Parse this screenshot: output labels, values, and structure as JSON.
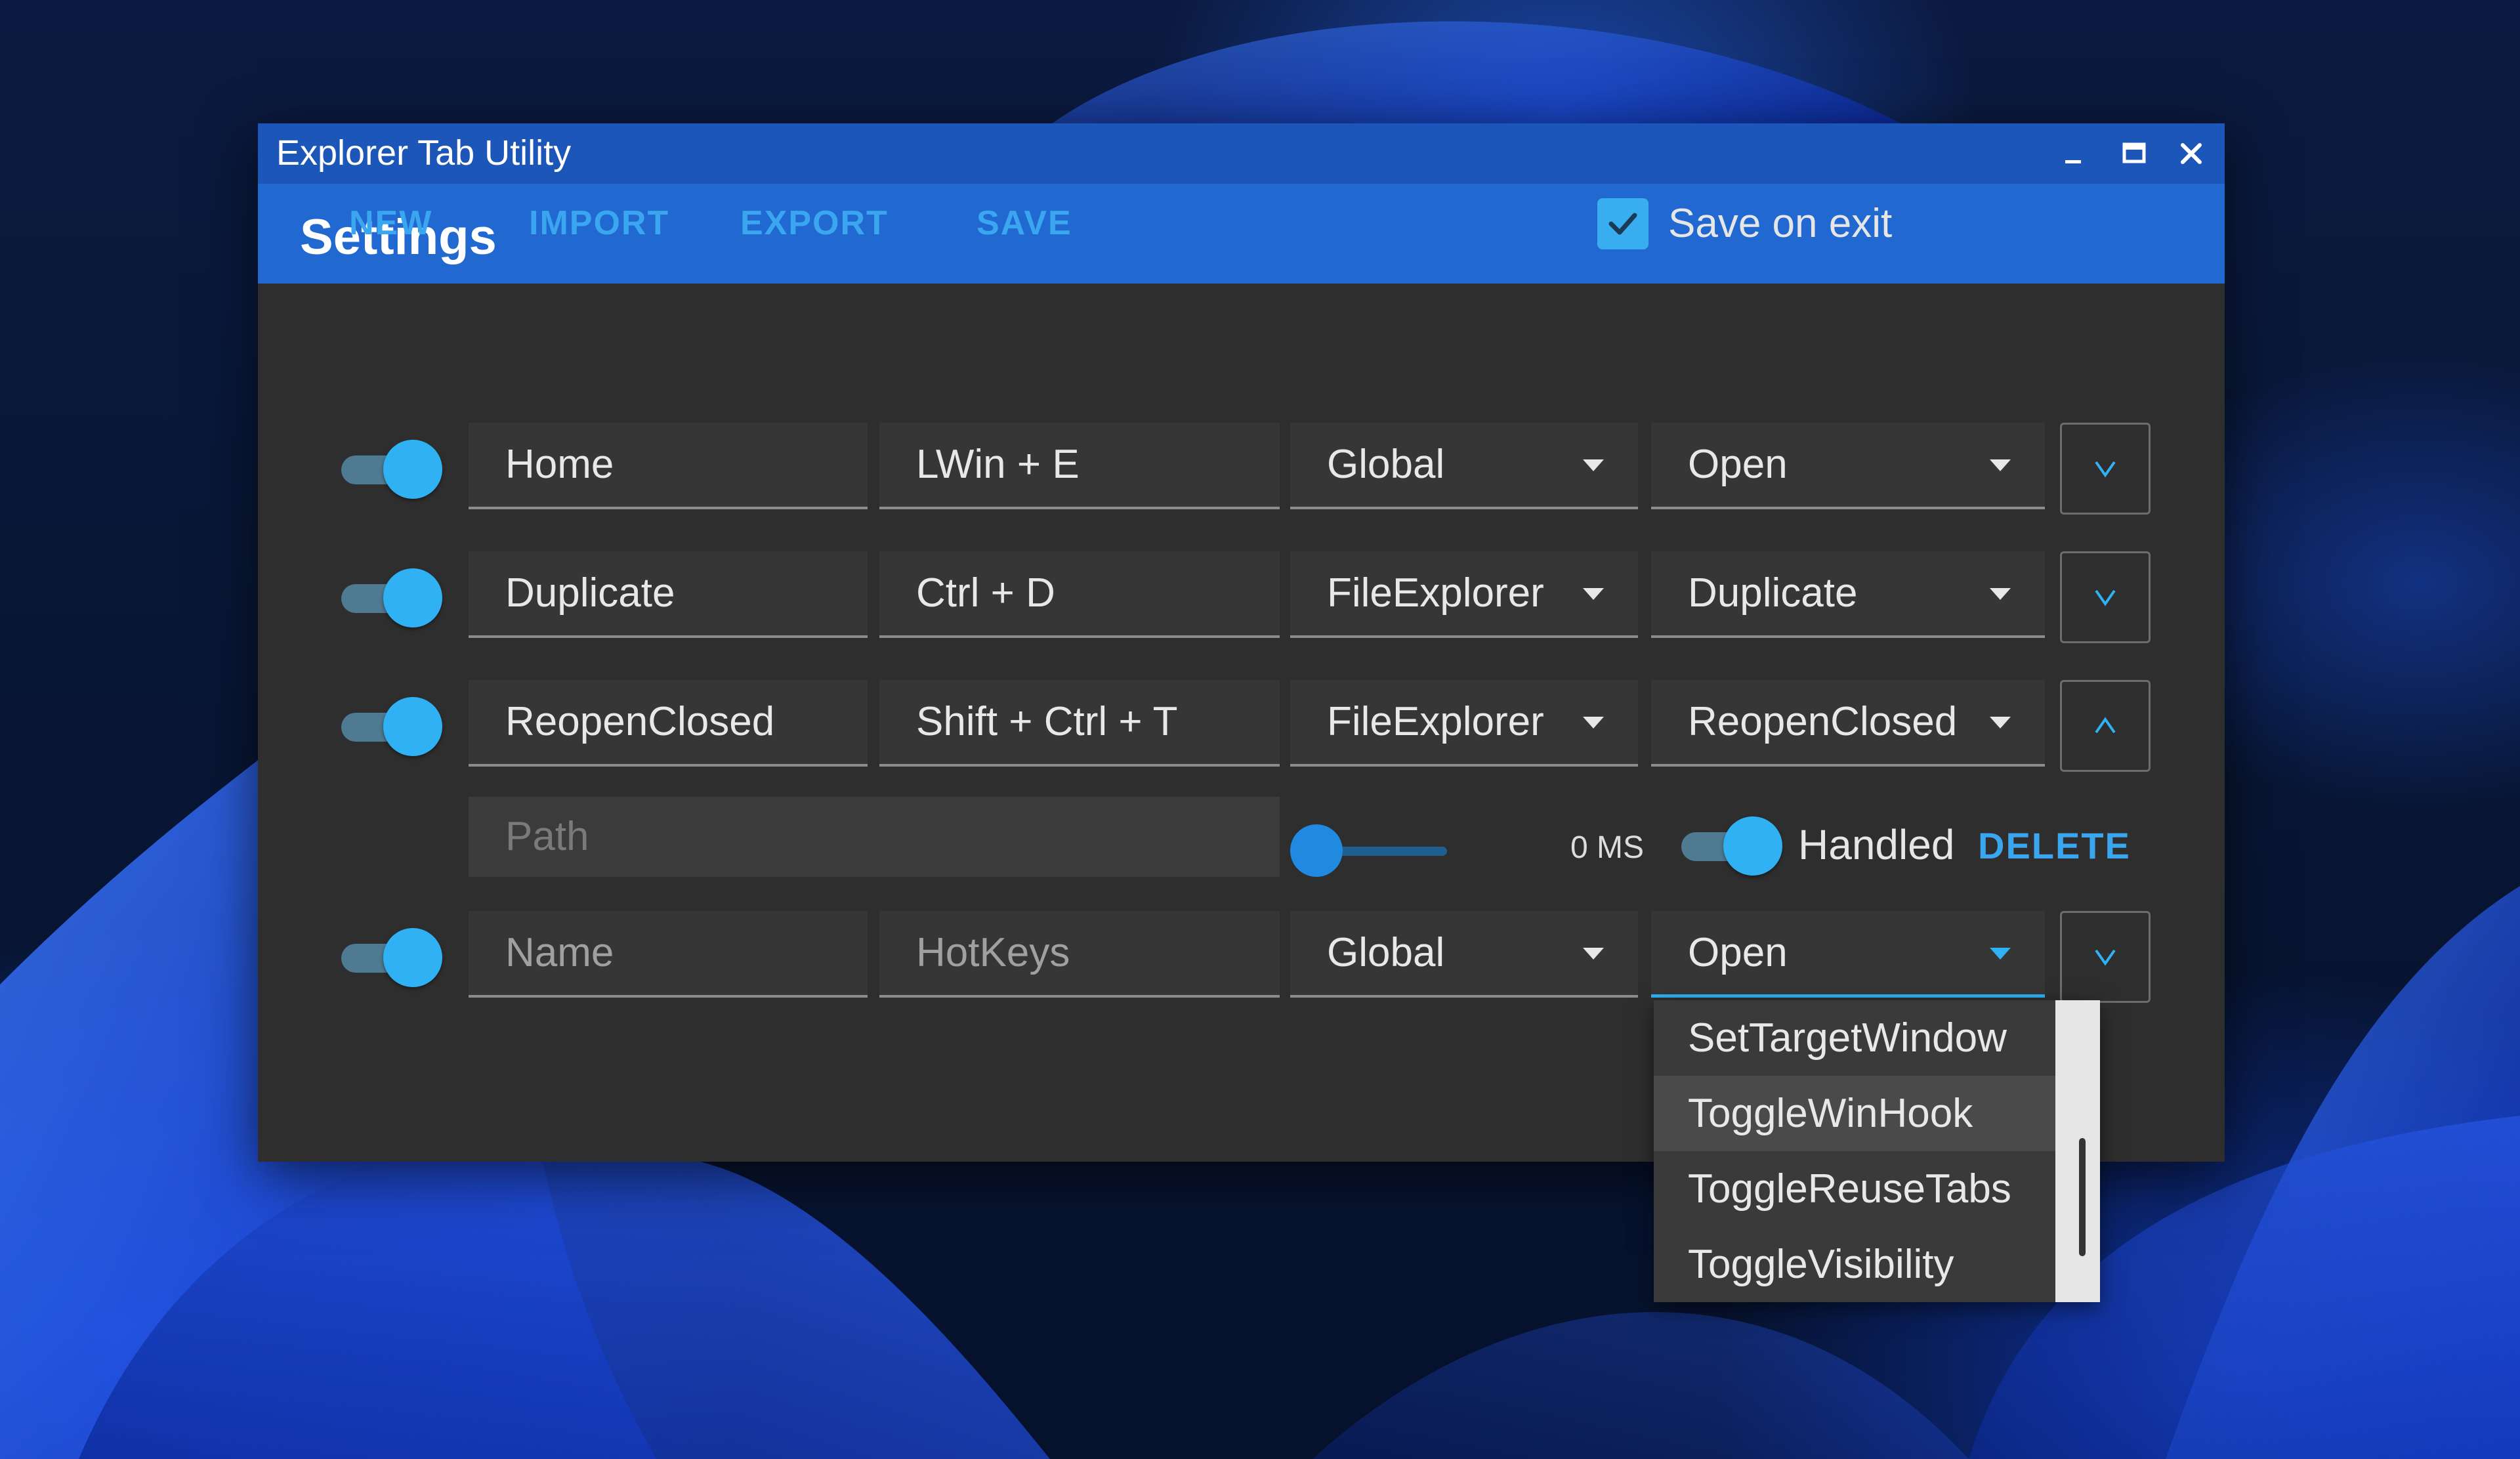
{
  "window": {
    "title": "Explorer Tab Utility",
    "controls": [
      "minimize-icon",
      "maximize-icon",
      "close-icon"
    ]
  },
  "header": {
    "title": "Settings"
  },
  "toolbar": {
    "new_label": "NEW",
    "import_label": "IMPORT",
    "export_label": "EXPORT",
    "save_label": "SAVE",
    "save_on_exit_label": "Save on exit",
    "save_on_exit_checked": true
  },
  "rows": [
    {
      "enabled": true,
      "name": "Home",
      "hotkeys": "LWin + E",
      "scope": "Global",
      "action": "Open",
      "expanded": false
    },
    {
      "enabled": true,
      "name": "Duplicate",
      "hotkeys": "Ctrl + D",
      "scope": "FileExplorer",
      "action": "Duplicate",
      "expanded": false
    },
    {
      "enabled": true,
      "name": "ReopenClosed",
      "hotkeys": "Shift + Ctrl + T",
      "scope": "FileExplorer",
      "action": "ReopenClosed",
      "expanded": true
    },
    {
      "enabled": true,
      "name_placeholder": "Name",
      "hotkeys_placeholder": "HotKeys",
      "scope": "Global",
      "action": "Open",
      "expanded": false
    }
  ],
  "details": {
    "path_placeholder": "Path",
    "delay_label": "0 MS",
    "delay_value_ms": 0,
    "handled_label": "Handled",
    "handled": true,
    "delete_label": "DELETE"
  },
  "action_dropdown": {
    "items": [
      "SetTargetWindow",
      "ToggleWinHook",
      "ToggleReuseTabs",
      "ToggleVisibility"
    ],
    "hovered_index": 1
  },
  "colors": {
    "accent": "#2fb1f3",
    "titlebar": "#1b56b8",
    "header": "#2168d0",
    "panel": "#2e2e2e"
  }
}
